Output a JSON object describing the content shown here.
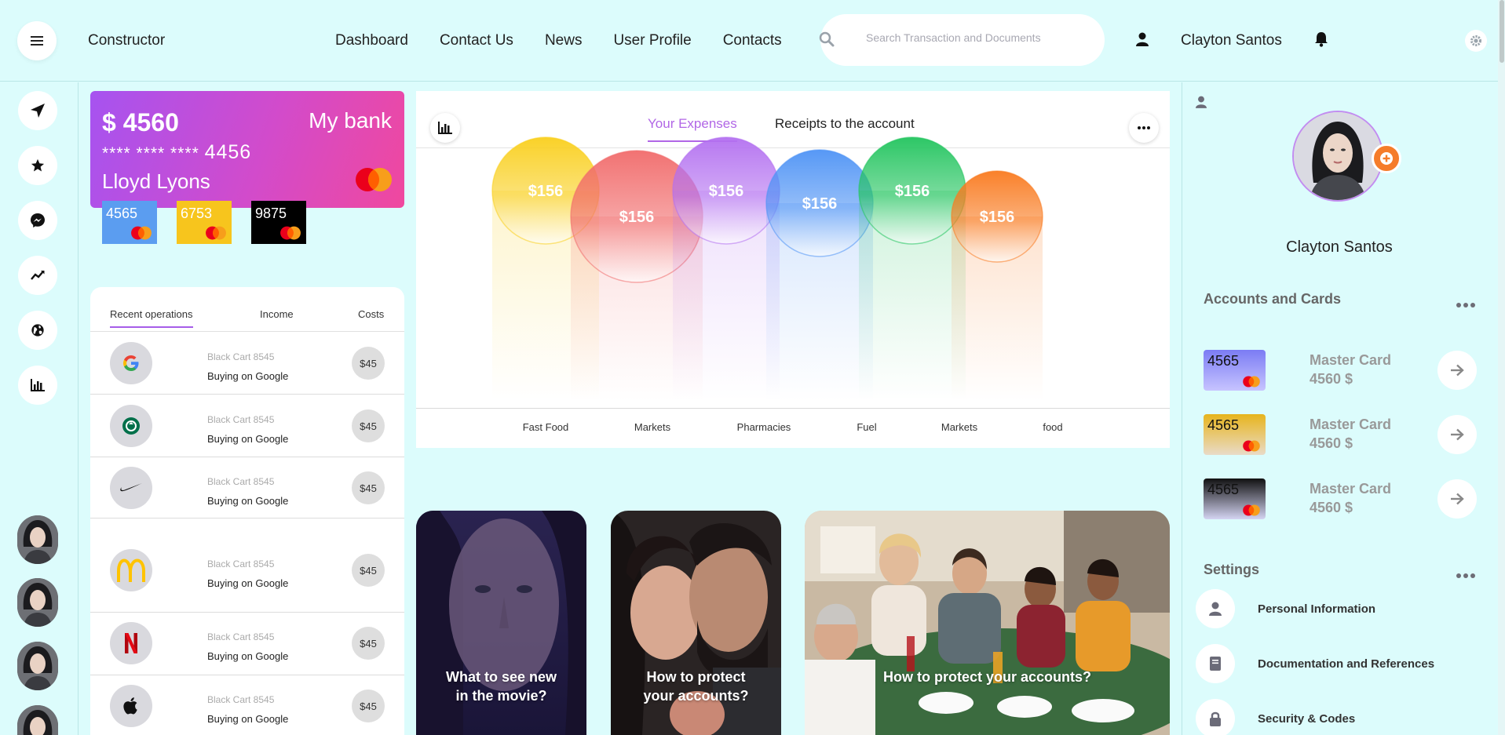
{
  "topbar": {
    "brand": "Constructor",
    "nav": [
      "Dashboard",
      "Contact Us",
      "News",
      "User Profile",
      "Contacts"
    ],
    "search_placeholder": "Search Transaction and Documents",
    "user_name": "Clayton Santos",
    "icons": [
      "menu-icon",
      "search-icon",
      "user-icon",
      "bell-icon",
      "gear-icon"
    ]
  },
  "rail": {
    "icons": [
      "send-icon",
      "star-icon",
      "messenger-icon",
      "trend-icon",
      "globe-icon",
      "bar-chart-icon"
    ]
  },
  "bank_card": {
    "balance": "$ 4560",
    "bank_name": "My bank",
    "number_masked": "**** **** ****",
    "number_last": "4456",
    "holder": "Lloyd Lyons"
  },
  "mini_cards": [
    {
      "number": "4565",
      "color": "#5b9df0"
    },
    {
      "number": "6753",
      "color": "#f7c51d"
    },
    {
      "number": "9875",
      "color": "#000000"
    }
  ],
  "operations": {
    "tabs": [
      "Recent operations",
      "Income",
      "Costs"
    ],
    "rows": [
      {
        "logo": "google-icon",
        "card": "Black Cart 8545",
        "desc": "Buying on Google",
        "amount": "$45"
      },
      {
        "logo": "starbucks-icon",
        "card": "Black Cart 8545",
        "desc": "Buying on Google",
        "amount": "$45"
      },
      {
        "logo": "nike-icon",
        "card": "Black Cart 8545",
        "desc": "Buying on Google",
        "amount": "$45"
      },
      {
        "logo": "mcdonalds-icon",
        "card": "Black Cart 8545",
        "desc": "Buying on Google",
        "amount": "$45"
      },
      {
        "logo": "netflix-icon",
        "card": "Black Cart 8545",
        "desc": "Buying on Google",
        "amount": "$45"
      },
      {
        "logo": "apple-icon",
        "card": "Black Cart 8545",
        "desc": "Buying on Google",
        "amount": "$45"
      }
    ]
  },
  "expenses": {
    "tabs": [
      "Your Expenses",
      "Receipts to the account"
    ],
    "bubbles": [
      {
        "label": "$156",
        "category": "Fast Food",
        "color": "#f9cf1d"
      },
      {
        "label": "$156",
        "category": "Markets",
        "color": "#f16b6b"
      },
      {
        "label": "$156",
        "category": "Pharmacies",
        "color": "#b370f0"
      },
      {
        "label": "$156",
        "category": "Fuel",
        "color": "#4e93f5"
      },
      {
        "label": "$156",
        "category": "Markets",
        "color": "#22c45e"
      },
      {
        "label": "$156",
        "category": "food",
        "color": "#f97a1f"
      }
    ]
  },
  "tiles": [
    {
      "title_line1": "What to see new",
      "title_line2": "in the movie?"
    },
    {
      "title_line1": "How to protect",
      "title_line2": "your accounts?"
    },
    {
      "title_line1": "How to protect your accounts?",
      "title_line2": ""
    }
  ],
  "profile": {
    "name": "Clayton Santos",
    "accounts_title": "Accounts and Cards",
    "accounts": [
      {
        "number": "4565",
        "name": "Master Card",
        "amount": "4560 $"
      },
      {
        "number": "4565",
        "name": "Master Card",
        "amount": "4560 $"
      },
      {
        "number": "4565",
        "name": "Master Card",
        "amount": "4560 $"
      }
    ],
    "settings_title": "Settings",
    "settings": [
      {
        "label": "Personal Information",
        "icon": "person-icon"
      },
      {
        "label": "Documentation and References",
        "icon": "book-icon"
      },
      {
        "label": "Security & Codes",
        "icon": "lock-icon"
      }
    ]
  },
  "colors": {
    "background": "#dcfcfc",
    "accent": "#b166e6",
    "orange": "#f57c2a"
  }
}
